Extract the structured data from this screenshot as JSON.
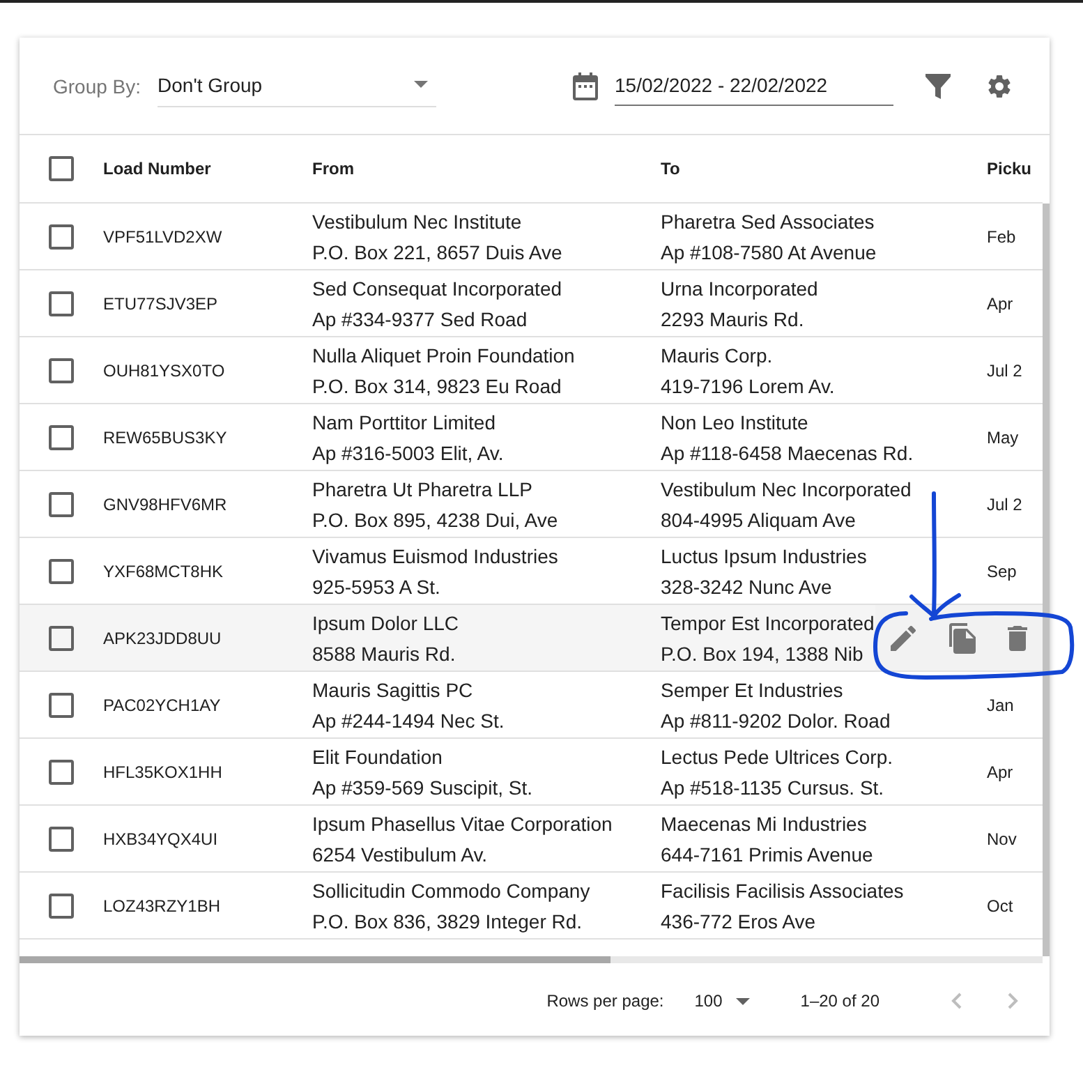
{
  "toolbar": {
    "group_by": {
      "label": "Group By:",
      "value": "Don't Group"
    },
    "date_range": {
      "value": "15/02/2022 - 22/02/2022"
    }
  },
  "table": {
    "all_checked": false,
    "columns": [
      "Load Number",
      "From",
      "To",
      "Picku"
    ],
    "rows": [
      {
        "checked": false,
        "hovered": false,
        "load": "VPF51LVD2XW",
        "from": [
          "Vestibulum Nec Institute",
          "P.O. Box 221, 8657 Duis Ave"
        ],
        "to": [
          "Pharetra Sed Associates",
          "Ap #108-7580 At Avenue"
        ],
        "pickup": "Feb"
      },
      {
        "checked": false,
        "hovered": false,
        "load": "ETU77SJV3EP",
        "from": [
          "Sed Consequat Incorporated",
          "Ap #334-9377 Sed Road"
        ],
        "to": [
          "Urna Incorporated",
          "2293 Mauris Rd."
        ],
        "pickup": "Apr"
      },
      {
        "checked": false,
        "hovered": false,
        "load": "OUH81YSX0TO",
        "from": [
          "Nulla Aliquet Proin Foundation",
          "P.O. Box 314, 9823 Eu Road"
        ],
        "to": [
          "Mauris Corp.",
          "419-7196 Lorem Av."
        ],
        "pickup": "Jul 2"
      },
      {
        "checked": false,
        "hovered": false,
        "load": "REW65BUS3KY",
        "from": [
          "Nam Porttitor Limited",
          "Ap #316-5003 Elit, Av."
        ],
        "to": [
          "Non Leo Institute",
          "Ap #118-6458 Maecenas Rd."
        ],
        "pickup": "May"
      },
      {
        "checked": false,
        "hovered": false,
        "load": "GNV98HFV6MR",
        "from": [
          "Pharetra Ut Pharetra LLP",
          "P.O. Box 895, 4238 Dui, Ave"
        ],
        "to": [
          "Vestibulum Nec Incorporated",
          "804-4995 Aliquam Ave"
        ],
        "pickup": "Jul 2"
      },
      {
        "checked": false,
        "hovered": false,
        "load": "YXF68MCT8HK",
        "from": [
          "Vivamus Euismod Industries",
          "925-5953 A St."
        ],
        "to": [
          "Luctus Ipsum Industries",
          "328-3242 Nunc Ave"
        ],
        "pickup": "Sep"
      },
      {
        "checked": false,
        "hovered": true,
        "load": "APK23JDD8UU",
        "from": [
          "Ipsum Dolor LLC",
          "8588 Mauris Rd."
        ],
        "to": [
          "Tempor Est Incorporated",
          "P.O. Box 194, 1388 Nib"
        ]
      },
      {
        "checked": false,
        "hovered": false,
        "load": "PAC02YCH1AY",
        "from": [
          "Mauris Sagittis PC",
          "Ap #244-1494 Nec St."
        ],
        "to": [
          "Semper Et Industries",
          "Ap #811-9202 Dolor. Road"
        ],
        "pickup": "Jan"
      },
      {
        "checked": false,
        "hovered": false,
        "load": "HFL35KOX1HH",
        "from": [
          "Elit Foundation",
          "Ap #359-569 Suscipit, St."
        ],
        "to": [
          "Lectus Pede Ultrices Corp.",
          "Ap #518-1135 Cursus. St."
        ],
        "pickup": "Apr"
      },
      {
        "checked": false,
        "hovered": false,
        "load": "HXB34YQX4UI",
        "from": [
          "Ipsum Phasellus Vitae Corporation",
          "6254 Vestibulum Av."
        ],
        "to": [
          "Maecenas Mi Industries",
          "644-7161 Primis Avenue"
        ],
        "pickup": "Nov"
      },
      {
        "checked": false,
        "hovered": false,
        "load": "LOZ43RZY1BH",
        "from": [
          "Sollicitudin Commodo Company",
          "P.O. Box 836, 3829 Integer Rd."
        ],
        "to": [
          "Facilisis Facilisis Associates",
          "436-772 Eros Ave"
        ],
        "pickup": "Oct"
      }
    ]
  },
  "footer": {
    "rows_per_page_label": "Rows per page:",
    "rows_per_page": "100",
    "range": "1–20 of 20",
    "prev_disabled": true,
    "next_disabled": true
  }
}
